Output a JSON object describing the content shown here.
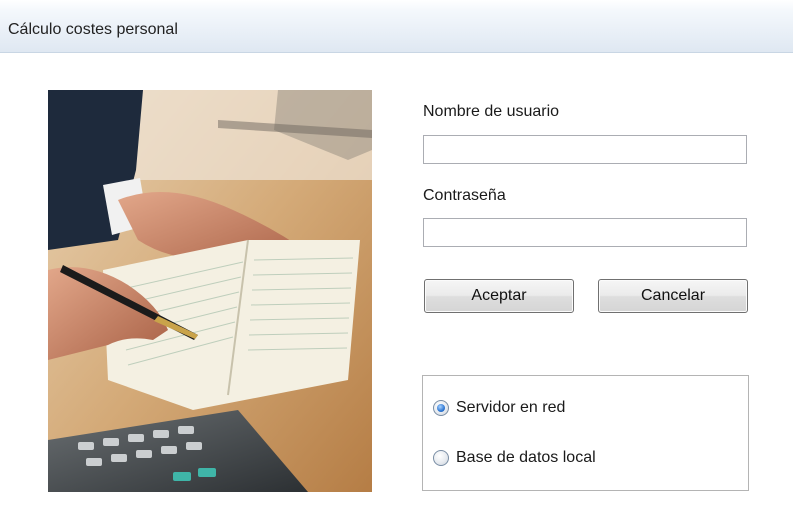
{
  "window": {
    "title": "Cálculo costes personal"
  },
  "photo": {
    "subject": "hands-writing-ledger-with-pen-and-calculator"
  },
  "login": {
    "username_label": "Nombre de usuario",
    "username_value": "",
    "password_label": "Contraseña",
    "password_value": ""
  },
  "buttons": {
    "accept_label": "Aceptar",
    "cancel_label": "Cancelar"
  },
  "connection": {
    "options": [
      {
        "label": "Servidor en red",
        "selected": true
      },
      {
        "label": "Base de datos local",
        "selected": false
      }
    ]
  },
  "colors": {
    "titlebar_bottom": "#dfe8f2",
    "radio_selected": "#2f78d4"
  }
}
